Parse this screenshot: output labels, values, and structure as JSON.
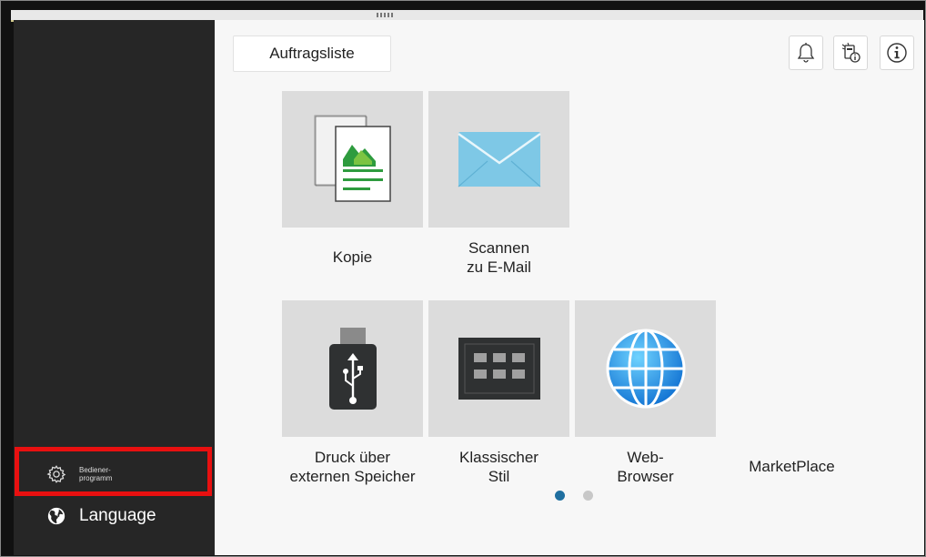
{
  "main": {
    "job_list_label": "Auftragsliste",
    "tiles": [
      {
        "label": "Kopie",
        "icon": "copy-icon"
      },
      {
        "label_line1": "Scannen",
        "label_line2": "zu E-Mail",
        "icon": "email-envelope-icon"
      },
      {
        "label_line1": "Druck über",
        "label_line2": "externen Speicher",
        "icon": "usb-drive-icon"
      },
      {
        "label_line1": "Klassischer",
        "label_line2": "Stil",
        "icon": "classic-keypad-icon"
      },
      {
        "label_line1": "Web-",
        "label_line2": "Browser",
        "icon": "globe-icon"
      },
      {
        "label": "MarketPlace"
      }
    ],
    "top_icons": [
      "bell-icon",
      "device-info-icon",
      "info-icon"
    ],
    "page_indicator": {
      "pages": 2,
      "current": 1
    }
  },
  "sidebar": {
    "admin_label_line1": "Bediener-",
    "admin_label_line2": "programm",
    "language_label": "Language"
  },
  "colors": {
    "sidebar_bg": "#262626",
    "main_bg": "#f7f7f7",
    "tile_bg": "#dcdcdc",
    "highlight": "#e81010",
    "active_dot": "#1f6fa0"
  }
}
